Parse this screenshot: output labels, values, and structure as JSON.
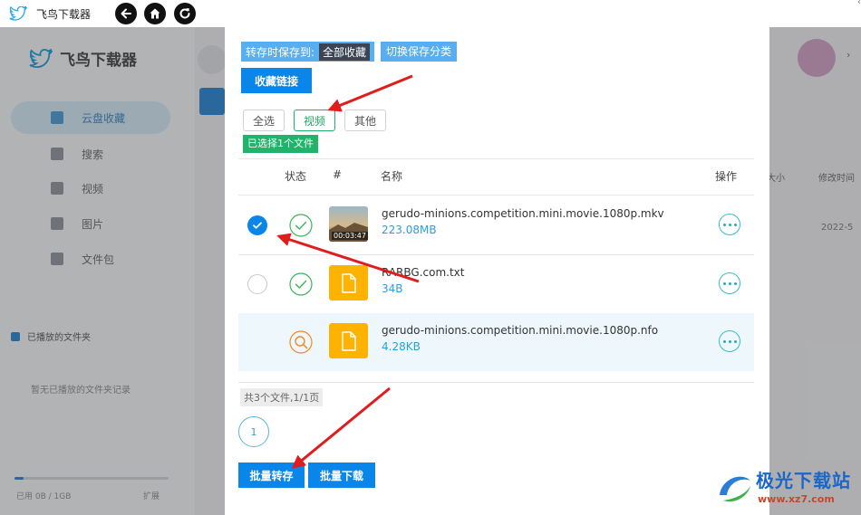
{
  "titlebar": {
    "app_name": "飞鸟下载器",
    "back_icon": "arrow-left-icon",
    "home_icon": "home-icon",
    "refresh_icon": "refresh-icon",
    "corner": "‹"
  },
  "background_app": {
    "brand": "飞鸟下载器",
    "sidebar_items": [
      {
        "label": "云盘收藏",
        "active": true
      },
      {
        "label": "搜索",
        "active": false
      },
      {
        "label": "视频",
        "active": false
      },
      {
        "label": "图片",
        "active": false
      },
      {
        "label": "文件包",
        "active": false
      }
    ],
    "section_title": "已播放的文件夹",
    "section_sub": "暂无已播放的文件夹记录",
    "storage_stats": "已用 0B / 1GB",
    "storage_fraction": 0.06,
    "extend": "扩展",
    "col_headers": [
      "大小",
      "修改时间"
    ],
    "date": "2022-5"
  },
  "dialog": {
    "save_to_label": "转存时保存到:",
    "save_to_target": "全部收藏",
    "switch_category": "切换保存分类",
    "collect_link": "收藏链接",
    "filters": [
      {
        "label": "全选",
        "active": false
      },
      {
        "label": "视频",
        "active": true
      },
      {
        "label": "其他",
        "active": false
      }
    ],
    "selected_badge": "已选择1个文件",
    "columns": {
      "status": "状态",
      "index": "#",
      "name": "名称",
      "action": "操作"
    },
    "files": [
      {
        "name": "gerudo-minions.competition.mini.movie.1080p.mkv",
        "size": "223.08MB",
        "checked": true,
        "status": "done",
        "type": "video",
        "duration": "00:03:47"
      },
      {
        "name": "RARBG.com.txt",
        "size": "34B",
        "checked": false,
        "status": "done",
        "type": "file"
      },
      {
        "name": "gerudo-minions.competition.mini.movie.1080p.nfo",
        "size": "4.28KB",
        "checked": null,
        "status": "searching",
        "type": "file"
      }
    ],
    "summary": "共3个文件,1/1页",
    "page": "1",
    "batch_save": "批量转存",
    "batch_download": "批量下载"
  },
  "watermark": {
    "title": "极光下载站",
    "url": "www.xz7.com"
  },
  "colors": {
    "primary": "#0a86ea",
    "green": "#22b36a",
    "cyan": "#3cb8c8",
    "orange": "#ffb300",
    "arrow": "#e01c1c"
  }
}
